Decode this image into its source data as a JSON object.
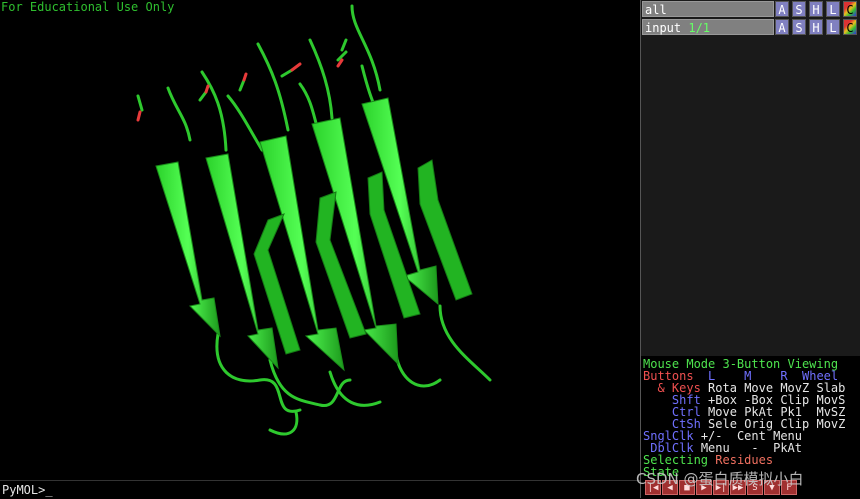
{
  "viewport": {
    "watermark": "For Educational Use Only",
    "background": "#000000",
    "cartoon_color": "#33ee33"
  },
  "command": {
    "prompt": "PyMOL>_",
    "value": ""
  },
  "objects": [
    {
      "name": "all",
      "count": "",
      "buttons": [
        "A",
        "S",
        "H",
        "L",
        "C"
      ]
    },
    {
      "name": "input",
      "count": "1/1",
      "buttons": [
        "A",
        "S",
        "H",
        "L",
        "C"
      ]
    }
  ],
  "mouse_mode": {
    "title_1": "Mouse Mode",
    "title_2": "3-Button Viewing",
    "header": [
      "Buttons",
      "L",
      "M",
      "R",
      "Wheel"
    ],
    "rows": [
      {
        "key": "& Keys",
        "values": [
          "Rota",
          "Move",
          "MovZ",
          "Slab"
        ]
      },
      {
        "key": "Shft",
        "values": [
          "+Box",
          "-Box",
          "Clip",
          "MovS"
        ]
      },
      {
        "key": "Ctrl",
        "values": [
          "Move",
          "PkAt",
          "Pk1",
          "MvSZ"
        ]
      },
      {
        "key": "CtSh",
        "values": [
          "Sele",
          "Orig",
          "Clip",
          "MovZ"
        ]
      },
      {
        "key": "SnglClk",
        "values": [
          "+/-",
          "Cent",
          "Menu",
          ""
        ]
      },
      {
        "key": "DblClk",
        "values": [
          "Menu",
          "-",
          "PkAt",
          ""
        ]
      }
    ],
    "selecting": [
      "Selecting",
      "Residues"
    ],
    "state": "State"
  },
  "movie_buttons": [
    "|◀",
    "◀",
    "■",
    "▶",
    "▶|",
    "▶▶",
    "S",
    "▼",
    "F"
  ],
  "watermark_overlay": "CSDN @蛋白质模拟小白"
}
